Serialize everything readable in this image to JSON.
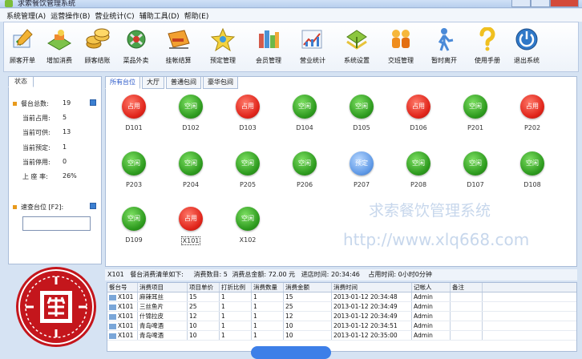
{
  "window": {
    "title": "求索餐饮管理系统"
  },
  "menu": [
    "系统管理(A)",
    "运营操作(B)",
    "营业统计(C)",
    "辅助工具(D)",
    "帮助(E)"
  ],
  "toolbar": [
    {
      "label": "顾客开单",
      "icon": "pen-check-icon"
    },
    {
      "label": "增加消费",
      "icon": "food-tray-icon"
    },
    {
      "label": "顾客结账",
      "icon": "coins-icon"
    },
    {
      "label": "菜品外卖",
      "icon": "takeout-icon"
    },
    {
      "label": "挂帐结算",
      "icon": "card-icon"
    },
    {
      "label": "预定管理",
      "icon": "bell-icon"
    },
    {
      "label": "会员管理",
      "icon": "members-icon"
    },
    {
      "label": "营业统计",
      "icon": "chart-icon"
    },
    {
      "label": "系统设置",
      "icon": "settings-icon"
    },
    {
      "label": "交班管理",
      "icon": "handover-icon"
    },
    {
      "label": "暂时离开",
      "icon": "walk-away-icon"
    },
    {
      "label": "使用手册",
      "icon": "question-icon"
    },
    {
      "label": "退出系统",
      "icon": "power-icon"
    }
  ],
  "status": {
    "tab": "状态",
    "total_label": "餐台总数:",
    "total": "19",
    "occupied_label": "当前占用:",
    "occupied": "5",
    "available_label": "当前可供:",
    "available": "13",
    "reserved_label": "当前预定:",
    "reserved": "1",
    "disabled_label": "当前停用:",
    "disabled": "0",
    "rate_label": "上 座 率:",
    "rate": "26%"
  },
  "search": {
    "label": "速查台位 [F2]:",
    "value": ""
  },
  "tabs": [
    "所有台位",
    "大厅",
    "普通包间",
    "豪华包间"
  ],
  "tables": [
    {
      "name": "D101",
      "state": "占用",
      "status": "busy"
    },
    {
      "name": "D102",
      "state": "空闲",
      "status": "free"
    },
    {
      "name": "D103",
      "state": "占用",
      "status": "busy"
    },
    {
      "name": "D104",
      "state": "空闲",
      "status": "free"
    },
    {
      "name": "D105",
      "state": "空闲",
      "status": "free"
    },
    {
      "name": "D106",
      "state": "占用",
      "status": "busy"
    },
    {
      "name": "P201",
      "state": "空闲",
      "status": "free"
    },
    {
      "name": "P202",
      "state": "占用",
      "status": "busy"
    },
    {
      "name": "P203",
      "state": "空闲",
      "status": "free"
    },
    {
      "name": "P204",
      "state": "空闲",
      "status": "free"
    },
    {
      "name": "P205",
      "state": "空闲",
      "status": "free"
    },
    {
      "name": "P206",
      "state": "空闲",
      "status": "free"
    },
    {
      "name": "P207",
      "state": "预定",
      "status": "reserved"
    },
    {
      "name": "P208",
      "state": "空闲",
      "status": "free"
    },
    {
      "name": "D107",
      "state": "空闲",
      "status": "free"
    },
    {
      "name": "D108",
      "state": "空闲",
      "status": "free"
    },
    {
      "name": "D109",
      "state": "空闲",
      "status": "free"
    },
    {
      "name": "X101",
      "state": "占用",
      "status": "busy",
      "selected": true
    },
    {
      "name": "X102",
      "state": "空闲",
      "status": "free"
    }
  ],
  "watermark": {
    "line1": "求索餐饮管理系统",
    "line2": "http://www.xlq668.com"
  },
  "info": {
    "table": "X101",
    "detail_label": "餐台消费清单如下:",
    "count_label": "消费数目:",
    "count": "5",
    "total_label": "消费总金额:",
    "total": "72.00 元",
    "enter_label": "进店时间:",
    "enter_time": "20:34:46",
    "occupy_label": "占用时间:",
    "occupy_time": "0小时0分钟"
  },
  "grid": {
    "headers": [
      "餐台号",
      "消费项目",
      "项目单价",
      "打折比例",
      "消费数量",
      "消费金额",
      "消费时间",
      "记帐人",
      "备注"
    ],
    "rows": [
      [
        "X101",
        "麻辣耳丝",
        "15",
        "1",
        "1",
        "15",
        "2013-01-12 20:34:48",
        "Admin",
        ""
      ],
      [
        "X101",
        "三丝鱼片",
        "25",
        "1",
        "1",
        "25",
        "2013-01-12 20:34:49",
        "Admin",
        ""
      ],
      [
        "X101",
        "什锦拉皮",
        "12",
        "1",
        "1",
        "12",
        "2013-01-12 20:34:49",
        "Admin",
        ""
      ],
      [
        "X101",
        "青岛啤酒",
        "10",
        "1",
        "1",
        "10",
        "2013-01-12 20:34:51",
        "Admin",
        ""
      ],
      [
        "X101",
        "青岛啤酒",
        "10",
        "1",
        "1",
        "10",
        "2013-01-12 20:35:00",
        "Admin",
        ""
      ]
    ]
  },
  "colors": {
    "free": "#2d9a1e",
    "busy": "#e0241a",
    "reserved": "#5f99e6",
    "seal": "#c4161c"
  }
}
